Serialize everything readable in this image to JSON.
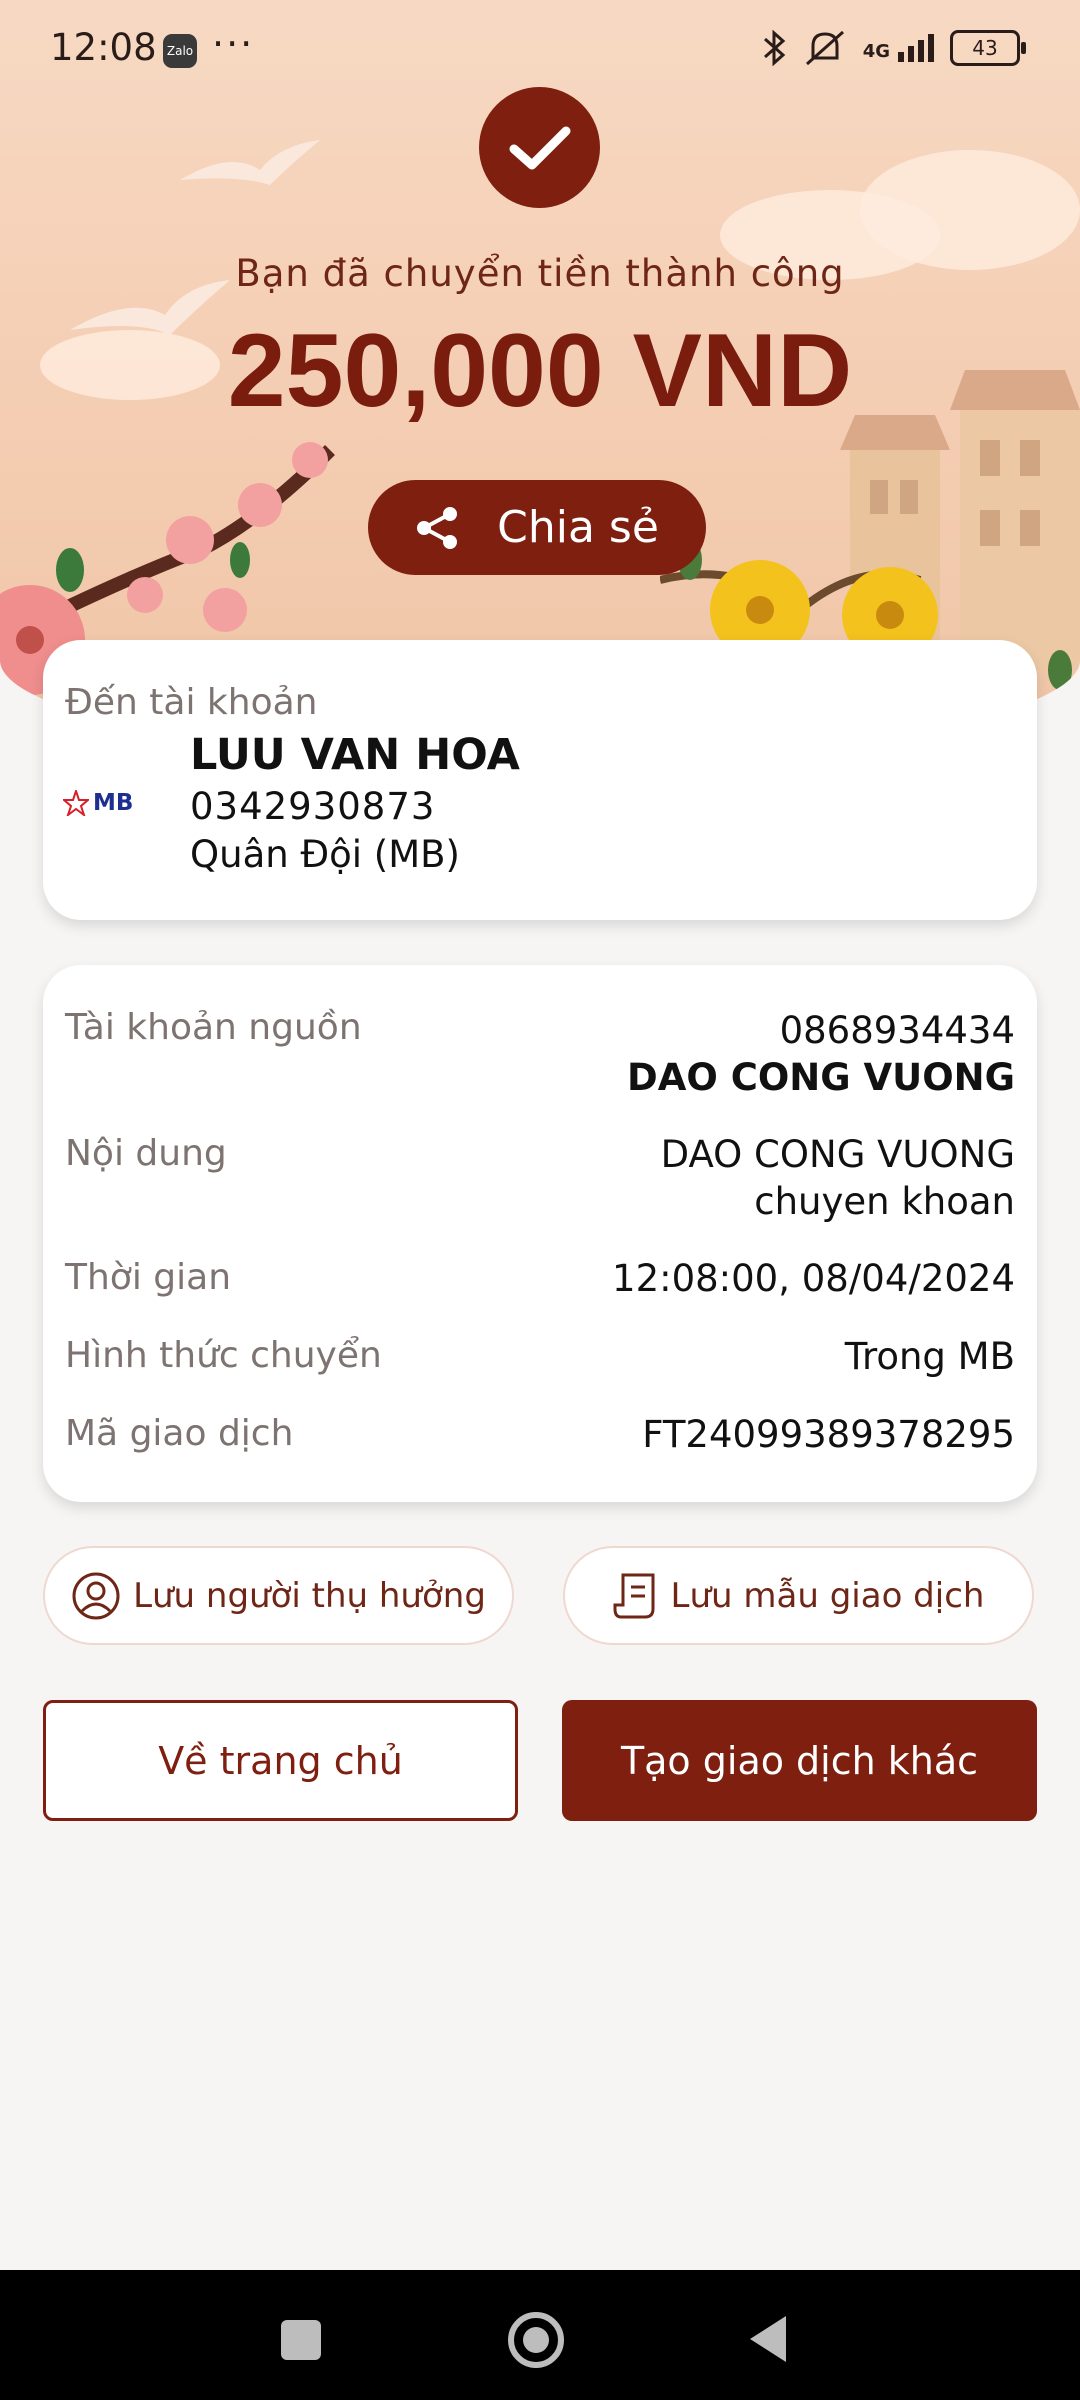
{
  "status_bar": {
    "time": "12:08",
    "zalo_label": "Zalo",
    "more": "···",
    "network": "4G",
    "battery": "43"
  },
  "hero": {
    "title": "Bạn đã chuyển tiền thành công",
    "amount": "250,000 VND",
    "share_label": "Chia sẻ"
  },
  "recipient": {
    "label": "Đến tài khoản",
    "bank_logo": "MB",
    "name": "LUU VAN HOA",
    "account": "0342930873",
    "bank": "Quân Đội (MB)"
  },
  "details": {
    "source_label": "Tài khoản nguồn",
    "source_account": "0868934434",
    "source_name": "DAO CONG VUONG",
    "content_label": "Nội dung",
    "content_line1": "DAO CONG VUONG",
    "content_line2": "chuyen khoan",
    "time_label": "Thời gian",
    "time_value": "12:08:00, 08/04/2024",
    "method_label": "Hình thức chuyển",
    "method_value": "Trong MB",
    "txn_label": "Mã giao dịch",
    "txn_value": "FT24099389378295"
  },
  "actions": {
    "save_beneficiary": "Lưu người thụ hưởng",
    "save_template": "Lưu mẫu giao dịch",
    "home": "Về trang chủ",
    "new_transaction": "Tạo giao dịch khác"
  },
  "colors": {
    "brand": "#7e1f10",
    "hero_bg": "#f4cdb2",
    "page_bg": "#f6f5f4"
  }
}
